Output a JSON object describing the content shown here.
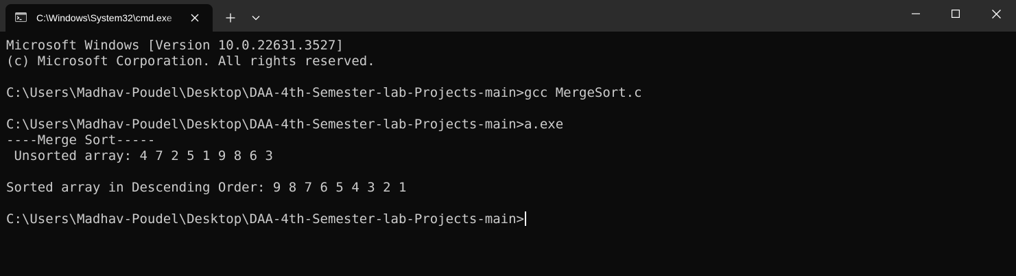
{
  "window": {
    "tab_title": "C:\\Windows\\System32\\cmd.exe",
    "icons": {
      "tab_icon": "terminal-icon",
      "tab_close": "close-icon",
      "new_tab": "plus-icon",
      "dropdown": "chevron-down-icon",
      "minimize": "minimize-icon",
      "maximize": "maximize-icon",
      "close": "close-icon"
    }
  },
  "colors": {
    "titlebar_bg": "#2c2c2c",
    "terminal_bg": "#0c0c0c",
    "text": "#cccccc"
  },
  "terminal": {
    "lines": [
      "Microsoft Windows [Version 10.0.22631.3527]",
      "(c) Microsoft Corporation. All rights reserved.",
      "",
      "C:\\Users\\Madhav-Poudel\\Desktop\\DAA-4th-Semester-lab-Projects-main>gcc MergeSort.c",
      "",
      "C:\\Users\\Madhav-Poudel\\Desktop\\DAA-4th-Semester-lab-Projects-main>a.exe",
      "----Merge Sort-----",
      " Unsorted array: 4 7 2 5 1 9 8 6 3",
      "",
      "Sorted array in Descending Order: 9 8 7 6 5 4 3 2 1",
      "",
      "C:\\Users\\Madhav-Poudel\\Desktop\\DAA-4th-Semester-lab-Projects-main>"
    ]
  }
}
